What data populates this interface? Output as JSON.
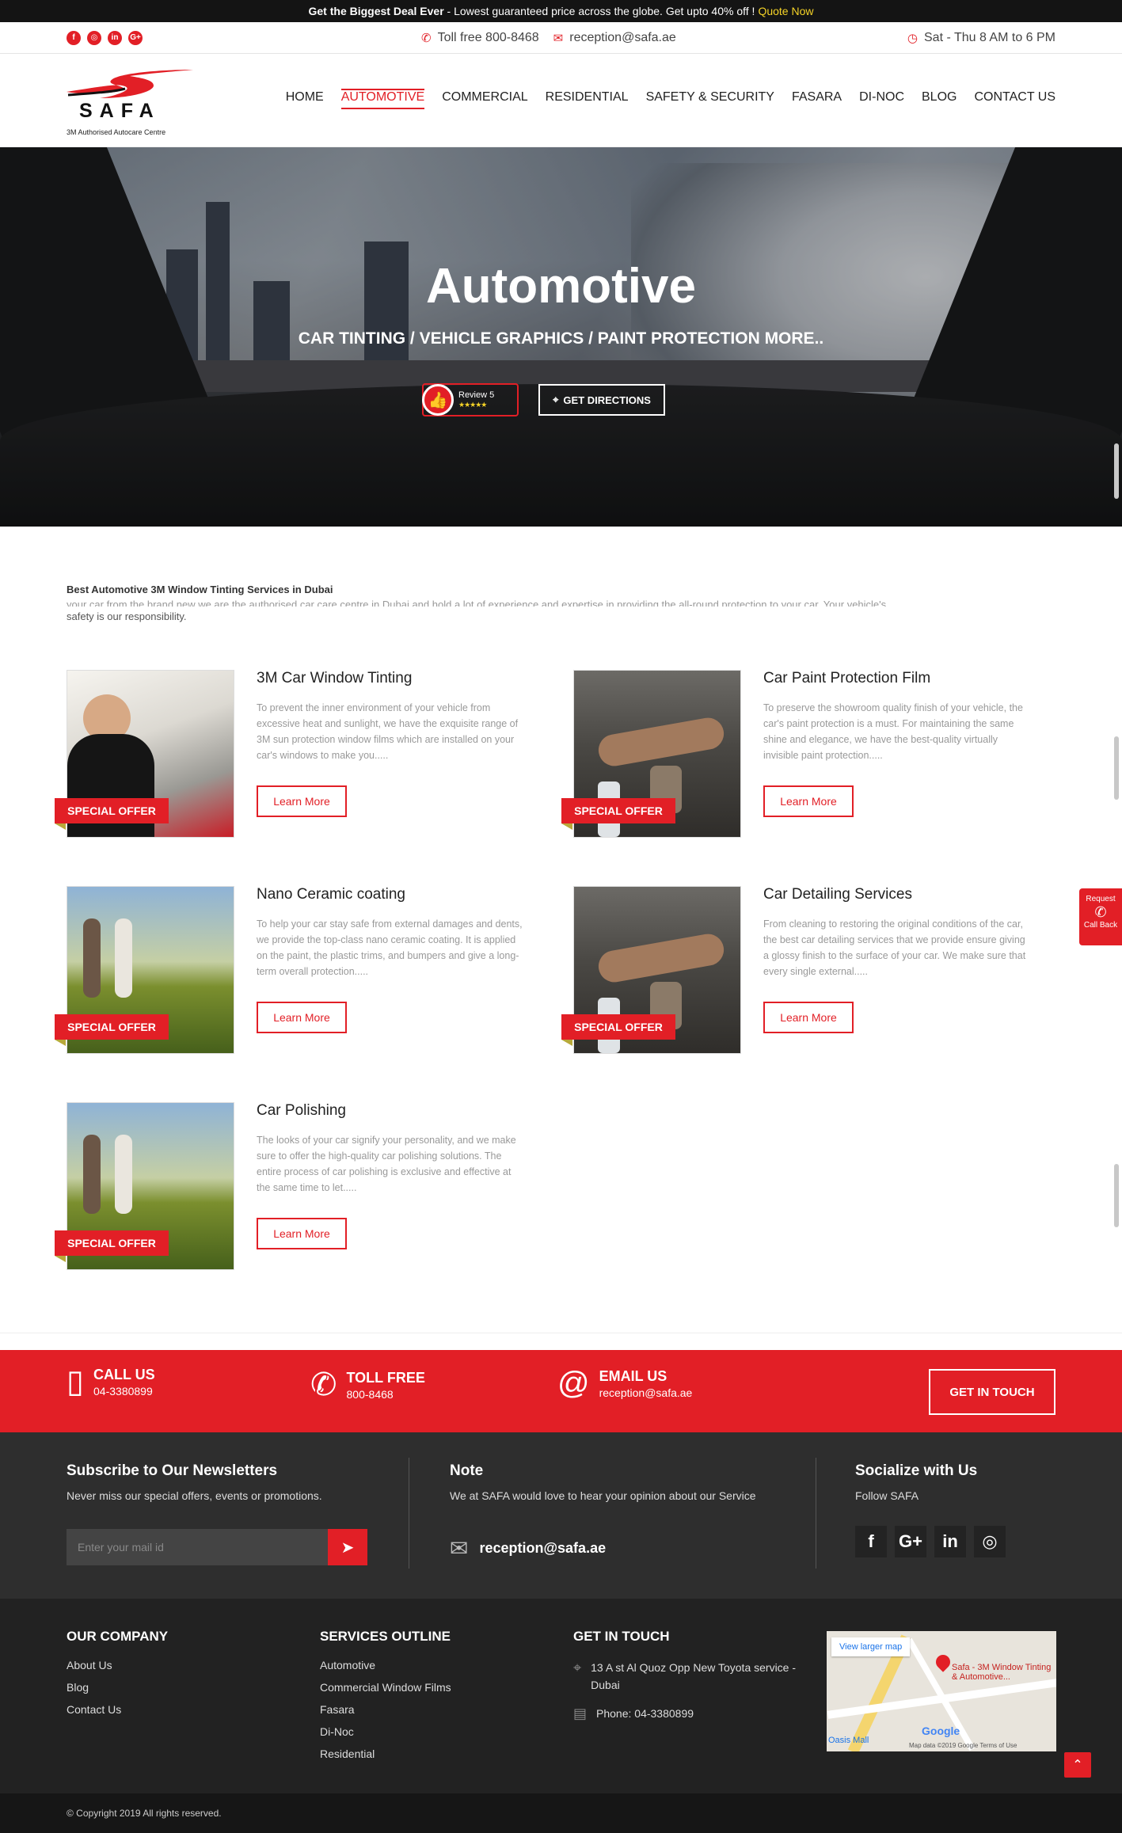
{
  "promo": {
    "bold": "Get the Biggest Deal Ever",
    "text": " - Lowest guaranteed price across the globe. Get upto 40% off !",
    "link": "Quote Now"
  },
  "topbar": {
    "socials": [
      "f",
      "◎",
      "in",
      "G+"
    ],
    "phone": "Toll free 800-8468",
    "email": "reception@safa.ae",
    "hours": "Sat - Thu 8 AM to 6 PM"
  },
  "logo": {
    "brand": "SAFA",
    "tagline": "3M Authorised Autocare Centre"
  },
  "nav": [
    "HOME",
    "AUTOMOTIVE",
    "COMMERCIAL",
    "RESIDENTIAL",
    "SAFETY & SECURITY",
    "FASARA",
    "DI-NOC",
    "BLOG",
    "CONTACT US"
  ],
  "hero": {
    "title": "Automotive",
    "subtitle": "CAR TINTING / VEHICLE GRAPHICS / PAINT PROTECTION MORE..",
    "review_label": "Review 5",
    "review_stars": "★★★★★",
    "directions": "GET DIRECTIONS"
  },
  "intro": {
    "title": "Best Automotive 3M Window Tinting Services in Dubai",
    "clipped": "your car from the brand new we are the authorised car care centre in Dubai and hold a lot of experience and expertise in providing the all-round protection to your car. Your vehicle's",
    "text": "safety is our responsibility."
  },
  "services": [
    {
      "title": "3M Car Window Tinting",
      "desc": "To prevent the inner environment of your vehicle from excessive heat and sunlight, we have the exquisite range of 3M sun protection window films which are installed on your car's windows to make you.....",
      "badge": "SPECIAL OFFER",
      "button": "Learn More"
    },
    {
      "title": "Car Paint Protection Film",
      "desc": "To preserve the showroom quality finish of your vehicle, the car's paint protection is a must. For maintaining the same shine and elegance, we have the best-quality virtually invisible paint protection.....",
      "badge": "SPECIAL OFFER",
      "button": "Learn More"
    },
    {
      "title": "Nano Ceramic coating",
      "desc": "To help your car stay safe from external damages and dents, we provide the top-class nano ceramic coating. It is applied on the paint, the plastic trims, and bumpers and give a long-term overall protection.....",
      "badge": "SPECIAL OFFER",
      "button": "Learn More"
    },
    {
      "title": "Car Detailing Services",
      "desc": "From cleaning to restoring the original conditions of the car, the best car detailing services that we provide ensure giving a glossy finish to the surface of your car. We make sure that every single external.....",
      "badge": "SPECIAL OFFER",
      "button": "Learn More"
    },
    {
      "title": "Car Polishing",
      "desc": "The looks of your car signify your personality, and we make sure to offer the high-quality car polishing solutions. The entire process of car polishing is exclusive and effective at the same time to let.....",
      "badge": "SPECIAL OFFER",
      "button": "Learn More"
    }
  ],
  "contact_bar": {
    "call_title": "CALL US",
    "call_value": "04-3380899",
    "toll_title": "TOLL FREE",
    "toll_value": "800-8468",
    "email_title": "EMAIL US",
    "email_value": "reception@safa.ae",
    "cta": "GET IN TOUCH"
  },
  "newsletter": {
    "title": "Subscribe to Our Newsletters",
    "subtitle": "Never miss our special offers, events or promotions.",
    "placeholder": "Enter your mail id",
    "note_title": "Note",
    "note_text": "We at SAFA would love to hear your opinion about our Service",
    "note_email": "reception@safa.ae",
    "social_title": "Socialize with Us",
    "social_sub": "Follow SAFA",
    "social_icons": [
      "f",
      "G+",
      "in",
      "◎"
    ]
  },
  "footer": {
    "company_title": "OUR COMPANY",
    "company_links": [
      "About Us",
      "Blog",
      "Contact Us"
    ],
    "services_title": "SERVICES OUTLINE",
    "services_links": [
      "Automotive",
      "Commercial Window Films",
      "Fasara",
      "Di-Noc",
      "Residential"
    ],
    "touch_title": "GET IN TOUCH",
    "address": "13 A st Al Quoz Opp New Toyota service - Dubai",
    "phone": "Phone: 04-3380899",
    "map_link": "View larger map",
    "map_place": "Safa - 3M Window Tinting & Automotive...",
    "map_data": "Map data ©2019 Google   Terms of Use",
    "map_brand": "Google",
    "map_oasis": "Oasis Mall",
    "copyright": "© Copyright 2019 All rights reserved."
  },
  "side_tab": {
    "top": "Request",
    "bottom": "Call Back"
  },
  "colors": {
    "brand_red": "#e21f26",
    "dark": "#2e2e2e",
    "footer": "#222222"
  }
}
